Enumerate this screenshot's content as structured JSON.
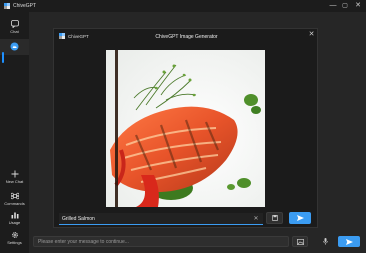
{
  "app": {
    "title": "ChiveGPT"
  },
  "window_controls": {
    "minimize": "—",
    "maximize": "▢",
    "close": "✕"
  },
  "sidebar": {
    "top_items": [
      {
        "label": "Chat",
        "icon": "chat-bubble-icon"
      },
      {
        "label": "",
        "icon": "image-gen-icon"
      }
    ],
    "bottom_items": [
      {
        "label": "New Chat",
        "icon": "plus-icon"
      },
      {
        "label": "Commands",
        "icon": "command-icon"
      },
      {
        "label": "Usage",
        "icon": "bar-chart-icon"
      },
      {
        "label": "Settings",
        "icon": "gear-icon"
      }
    ]
  },
  "composer": {
    "placeholder": "Please enter your message to continue..."
  },
  "dialog": {
    "app_name": "ChiveGPT",
    "title": "ChiveGPT Image Generator",
    "close": "✕",
    "prompt_value": "Grilled Salmon",
    "clear": "✕"
  },
  "colors": {
    "accent": "#3b9cf2",
    "background": "#202020"
  }
}
